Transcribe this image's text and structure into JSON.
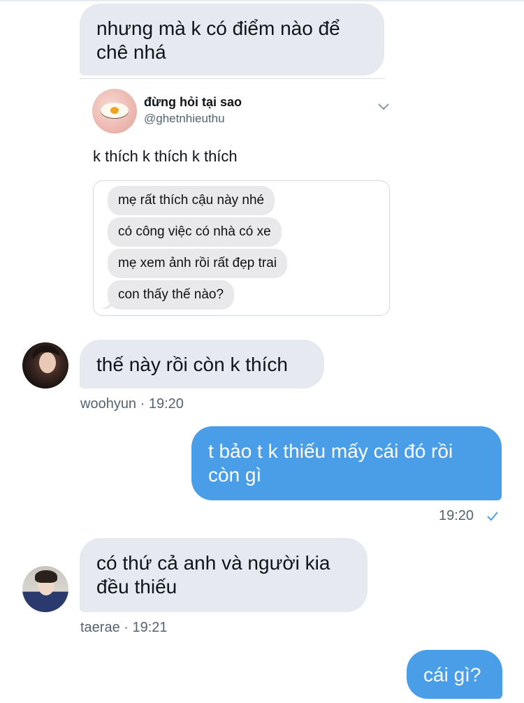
{
  "messages": {
    "m1": "nhưng mà k có điểm nào để chê nhá",
    "m2": "thế này rồi còn k thích",
    "m3": "t bảo t k thiếu mấy cái đó rồi còn gì",
    "m4": "có thứ cả anh và người kia đều thiếu",
    "m5": "cái gì?"
  },
  "quote": {
    "name": "đừng hỏi tại sao",
    "handle": "@ghetnhieuthu",
    "text": "k thích k thích k thích",
    "image_messages": [
      "mẹ rất thích cậu này nhé",
      "có công việc có nhà có xe",
      "mẹ xem ảnh rồi rất đẹp trai",
      "con thấy thế nào?"
    ]
  },
  "meta": {
    "woohyun": "woohyun · 19:20",
    "sent": "19:20",
    "taerae": "taerae · 19:21"
  },
  "icons": {
    "chevron": "chevron-down-icon",
    "check": "check-icon"
  },
  "colors": {
    "incoming_bubble": "#e6e9ef",
    "outgoing_bubble": "#4a9ee8",
    "meta_text": "#536471",
    "check": "#4a9ee8"
  }
}
